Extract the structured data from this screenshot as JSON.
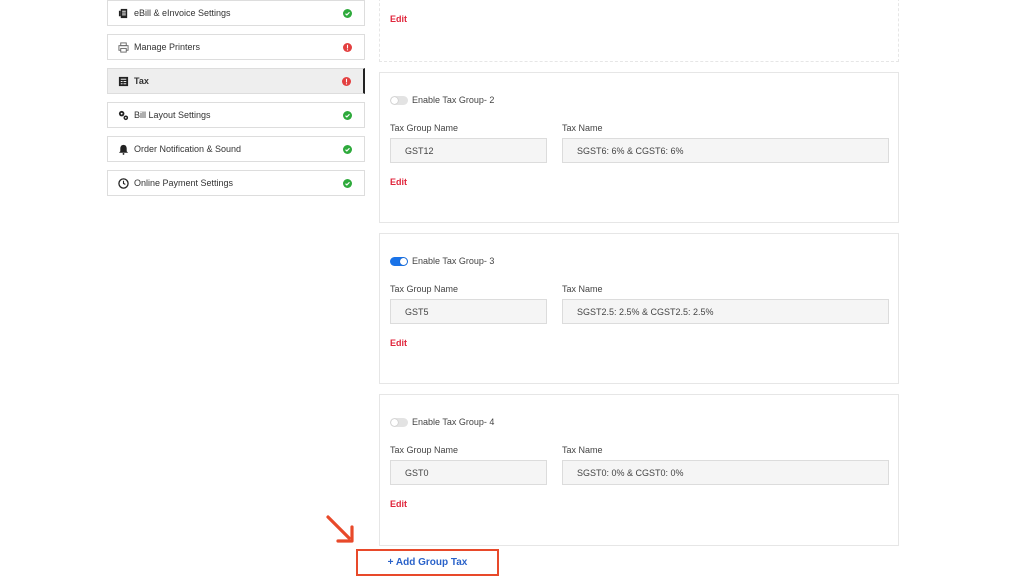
{
  "sidebar": {
    "items": [
      {
        "label": "eBill & eInvoice Settings",
        "icon": "receipt-icon",
        "status": "ok"
      },
      {
        "label": "Manage Printers",
        "icon": "printer-icon",
        "status": "error"
      },
      {
        "label": "Tax",
        "icon": "tax-document-icon",
        "status": "error",
        "active": true
      },
      {
        "label": "Bill Layout Settings",
        "icon": "layout-gears-icon",
        "status": "ok"
      },
      {
        "label": "Order Notification & Sound",
        "icon": "bell-icon",
        "status": "ok"
      },
      {
        "label": "Online Payment Settings",
        "icon": "clock-payment-icon",
        "status": "ok"
      }
    ],
    "status_colors": {
      "ok": "#2eaa3c",
      "error": "#e34040"
    }
  },
  "top_card": {
    "edit_label": "Edit"
  },
  "tax_groups": [
    {
      "toggle_label": "Enable Tax Group- 2",
      "enabled": false,
      "group_name_label": "Tax Group Name",
      "group_name_value": "GST12",
      "tax_name_label": "Tax Name",
      "tax_name_value": "SGST6: 6% & CGST6: 6%",
      "edit_label": "Edit"
    },
    {
      "toggle_label": "Enable Tax Group- 3",
      "enabled": true,
      "group_name_label": "Tax Group Name",
      "group_name_value": "GST5",
      "tax_name_label": "Tax Name",
      "tax_name_value": "SGST2.5: 2.5% & CGST2.5: 2.5%",
      "edit_label": "Edit"
    },
    {
      "toggle_label": "Enable Tax Group- 4",
      "enabled": false,
      "group_name_label": "Tax Group Name",
      "group_name_value": "GST0",
      "tax_name_label": "Tax Name",
      "tax_name_value": "SGST0: 0% & CGST0: 0%",
      "edit_label": "Edit"
    }
  ],
  "add_group_tax_label": "+ Add Group Tax",
  "colors": {
    "accent": "#1a73e8",
    "edit": "#e0263c",
    "highlight": "#e8492a",
    "link": "#2a62c9"
  }
}
